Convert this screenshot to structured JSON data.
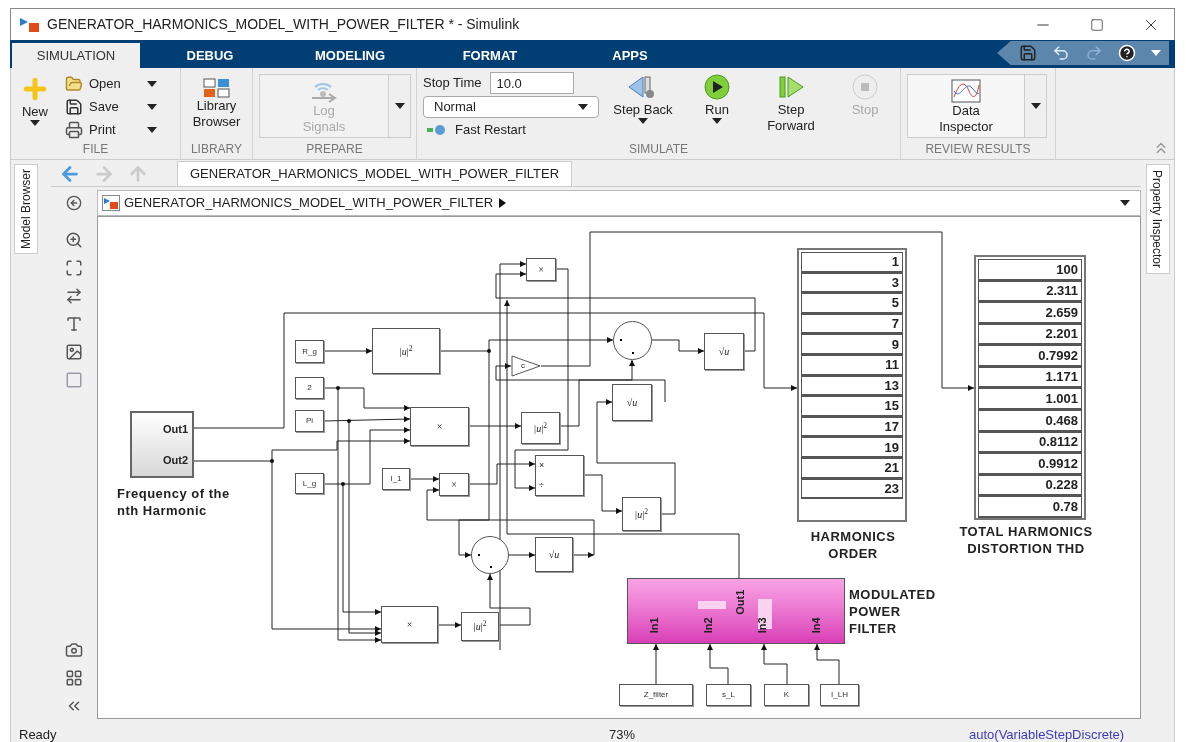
{
  "window": {
    "title": "GENERATOR_HARMONICS_MODEL_WITH_POWER_FILTER * - Simulink"
  },
  "ribbon_tabs": [
    {
      "label": "SIMULATION",
      "selected": true
    },
    {
      "label": "DEBUG",
      "selected": false
    },
    {
      "label": "MODELING",
      "selected": false
    },
    {
      "label": "FORMAT",
      "selected": false
    },
    {
      "label": "APPS",
      "selected": false
    }
  ],
  "file_group": {
    "new": "New",
    "open": "Open",
    "save": "Save",
    "print": "Print",
    "label": "FILE"
  },
  "library_group": {
    "button": "Library Browser",
    "label": "LIBRARY"
  },
  "prepare_group": {
    "button": "Log Signals",
    "disabled": true,
    "label": "PREPARE"
  },
  "simulate_group": {
    "stop_time_label": "Stop Time",
    "stop_time": "10.0",
    "mode": "Normal",
    "fast_restart": "Fast Restart",
    "label": "SIMULATE",
    "buttons": [
      {
        "kind": "step_back",
        "label": "Step Back",
        "menu": true,
        "disabled": false
      },
      {
        "kind": "run",
        "label": "Run",
        "menu": true,
        "disabled": false
      },
      {
        "kind": "step_forward",
        "label": "Step Forward",
        "menu": false,
        "disabled": false
      },
      {
        "kind": "stop",
        "label": "Stop",
        "menu": false,
        "disabled": true
      }
    ]
  },
  "review_group": {
    "button": "Data Inspector",
    "label": "REVIEW RESULTS"
  },
  "side_tabs": {
    "left": "Model Browser",
    "right": "Property Inspector"
  },
  "editor_tab": "GENERATOR_HARMONICS_MODEL_WITH_POWER_FILTER",
  "breadcrumb": "GENERATOR_HARMONICS_MODEL_WITH_POWER_FILTER",
  "diagram": {
    "blocks": [
      {
        "kind": "product",
        "label": "×"
      },
      {
        "kind": "constant",
        "label": "R_g"
      },
      {
        "kind": "math",
        "label": "|*u*|$^{2}$"
      },
      {
        "kind": "sum"
      },
      {
        "kind": "sqrt",
        "label": "√*u*"
      },
      {
        "kind": "gain",
        "label": "c"
      },
      {
        "kind": "constant",
        "label": "2"
      },
      {
        "kind": "sqrt",
        "label": "√*u*"
      },
      {
        "kind": "subsystem",
        "ports_out": [
          "Out1",
          "Out2"
        ]
      },
      {
        "kind": "constant",
        "label": "Pi"
      },
      {
        "kind": "product",
        "label": "×"
      },
      {
        "kind": "math",
        "label": "|*u*|$^{2}$"
      },
      {
        "kind": "constant",
        "label": "L_g"
      },
      {
        "kind": "constant",
        "label": "I_1"
      },
      {
        "kind": "product",
        "label": "×"
      },
      {
        "kind": "divide",
        "ports_in": [
          "×",
          "÷"
        ]
      },
      {
        "kind": "math",
        "label": "|*u*|$^{2}$"
      },
      {
        "kind": "sum"
      },
      {
        "kind": "sqrt",
        "label": "√*u*"
      },
      {
        "kind": "product",
        "label": "×"
      },
      {
        "kind": "math",
        "label": "|*u*|$^{2}$"
      },
      {
        "kind": "masked_subsystem",
        "ports_in": [
          "In1",
          "In2",
          "In3",
          "In4"
        ],
        "ports_out": [
          "Out1"
        ]
      },
      {
        "kind": "constant",
        "label": "Z_filter"
      },
      {
        "kind": "constant",
        "label": "s_L"
      },
      {
        "kind": "constant",
        "label": "K"
      },
      {
        "kind": "constant",
        "label": "I_LH"
      }
    ],
    "displays": [
      {
        "values": [
          "1",
          "3",
          "5",
          "7",
          "9",
          "11",
          "13",
          "15",
          "17",
          "19",
          "21",
          "23"
        ]
      },
      {
        "values": [
          "100",
          "2.311",
          "2.659",
          "2.201",
          "0.7992",
          "1.171",
          "1.001",
          "0.468",
          "0.8112",
          "0.9912",
          "0.228",
          "0.78"
        ]
      }
    ],
    "annotations": [
      {
        "text": "Frequency of the nth Harmonic"
      },
      {
        "text": "HARMONICS ORDER"
      },
      {
        "text": "TOTAL HARMONICS DISTORTION THD"
      },
      {
        "text": "MODULATED POWER FILTER"
      }
    ]
  },
  "status_bar": {
    "state": "Ready",
    "zoom": "73%",
    "solver": "auto(VariableStepDiscrete)"
  }
}
